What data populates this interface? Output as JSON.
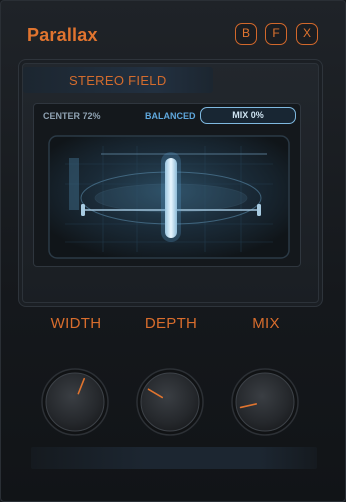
{
  "header": {
    "title": "Parallax",
    "buttons": [
      "B",
      "F",
      "X"
    ]
  },
  "stereo_panel": {
    "title": "STEREO FIELD",
    "center_text": "CENTER 72%",
    "balance_text": "BALANCED",
    "mix_text": "MIX 0%"
  },
  "knobs": [
    {
      "label": "WIDTH",
      "value": 0.58,
      "color": "#e0742f"
    },
    {
      "label": "DEPTH",
      "value": 0.28,
      "color": "#e0742f"
    },
    {
      "label": "MIX",
      "value": 0.12,
      "color": "#e0742f"
    }
  ],
  "colors": {
    "accent": "#e0742f",
    "scope_blue": "#7fb9e0"
  }
}
